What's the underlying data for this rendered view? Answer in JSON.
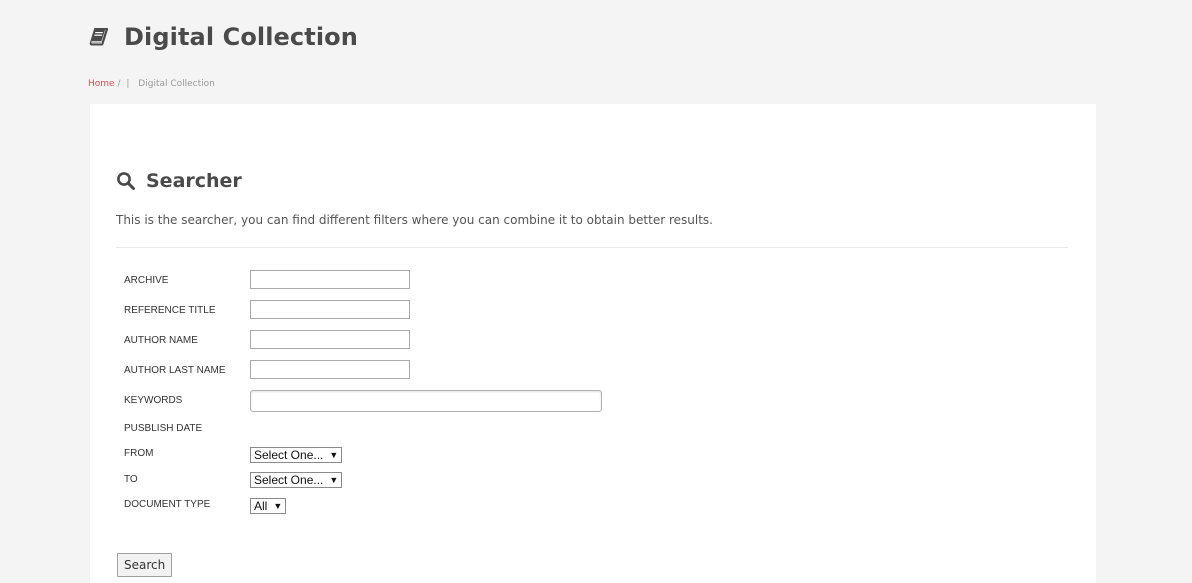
{
  "header": {
    "icon": "book-icon",
    "title": "Digital Collection"
  },
  "breadcrumb": {
    "home": "Home",
    "slash": "/",
    "separator": "|",
    "current": "Digital Collection"
  },
  "searcher": {
    "icon": "search-icon",
    "title": "Searcher",
    "description": "This is the searcher, you can find different filters where you can combine it to obtain better results."
  },
  "form": {
    "archive_label": "ARCHIVE",
    "archive_value": "",
    "reference_title_label": "REFERENCE TITLE",
    "reference_title_value": "",
    "author_name_label": "AUTHOR NAME",
    "author_name_value": "",
    "author_last_name_label": "AUTHOR LAST NAME",
    "author_last_name_value": "",
    "keywords_label": "KEYWORDS",
    "keywords_value": "",
    "publish_date_label": "PUSBLISH DATE",
    "from_label": "FROM",
    "from_selected": "Select One...",
    "to_label": "TO",
    "to_selected": "Select One...",
    "document_type_label": "DOCUMENT TYPE",
    "document_type_selected": "All",
    "caret": "▼",
    "search_button": "Search"
  },
  "colors": {
    "background": "#f4f4f4",
    "card": "#ffffff",
    "breadcrumb_link": "#d9534f",
    "heading": "#4a4a4a"
  }
}
